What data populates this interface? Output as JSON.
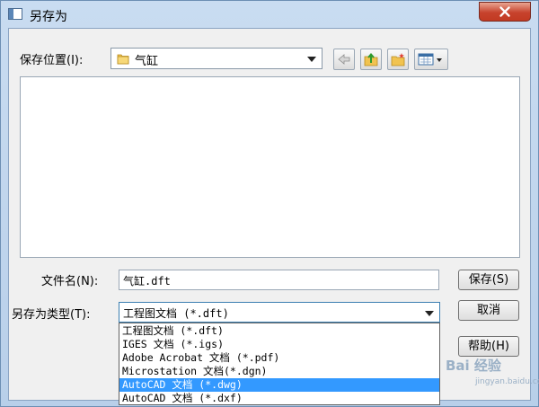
{
  "window": {
    "title": "另存为"
  },
  "save_in": {
    "label": "保存位置(I):",
    "value": "气缸"
  },
  "toolbar": {
    "icons": [
      "back-arrow-icon",
      "up-folder-icon",
      "new-folder-icon",
      "view-menu-icon"
    ]
  },
  "filename": {
    "label": "文件名(N):",
    "value": "气缸.dft"
  },
  "filetype": {
    "label": "另存为类型(T):",
    "value": "工程图文档 (*.dft)",
    "options": [
      "工程图文档 (*.dft)",
      "IGES 文档 (*.igs)",
      "Adobe Acrobat 文档 (*.pdf)",
      "Microstation 文档(*.dgn)",
      "AutoCAD 文档 (*.dwg)",
      "AutoCAD 文档 (*.dxf)"
    ],
    "selected_index": 4
  },
  "buttons": {
    "save": "保存(S)",
    "cancel": "取消",
    "help": "帮助(H)"
  },
  "watermark": {
    "main": "Bai 经验",
    "sub": "jingyan.baidu.com"
  },
  "colors": {
    "selection": "#3399ff",
    "close": "#c7432d"
  }
}
